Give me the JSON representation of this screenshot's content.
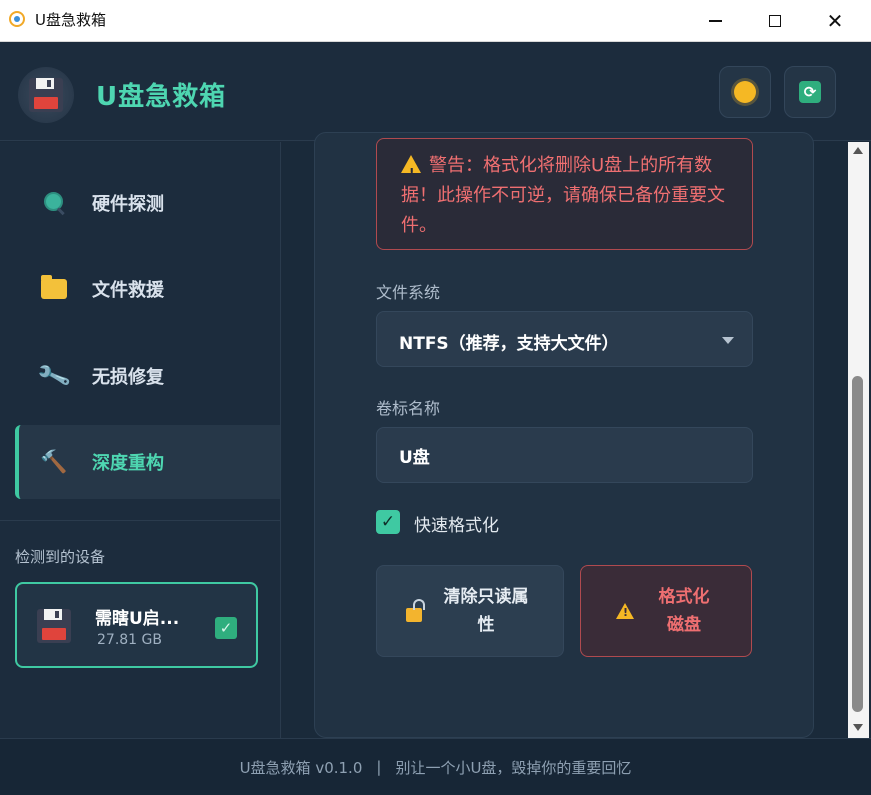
{
  "window": {
    "title": "U盘急救箱"
  },
  "header": {
    "brand": "U盘急救箱",
    "theme_icon": "sun-icon",
    "refresh_icon": "refresh-icon",
    "accent_color": "#4ed6b1"
  },
  "sidebar": {
    "items": [
      {
        "label": "硬件探测",
        "icon": "magnifier-icon",
        "active": false
      },
      {
        "label": "文件救援",
        "icon": "folder-icon",
        "active": false
      },
      {
        "label": "无损修复",
        "icon": "wrench-icon",
        "active": false
      },
      {
        "label": "深度重构",
        "icon": "hammer-icon",
        "active": true
      }
    ],
    "devices_title": "检测到的设备",
    "device": {
      "name": "需瞎U启...",
      "size": "27.81 GB",
      "checked": true
    }
  },
  "main": {
    "warning": "警告：格式化将删除U盘上的所有数据！此操作不可逆，请确保已备份重要文件。",
    "filesystem_label": "文件系统",
    "filesystem_value": "NTFS（推荐，支持大文件）",
    "volume_label": "卷标名称",
    "volume_value": "U盘",
    "quick_format_label": "快速格式化",
    "quick_format_checked": true,
    "clear_readonly_label": "清除只读属性",
    "format_label": "格式化磁盘",
    "danger_color": "#ef6f71"
  },
  "footer": {
    "version": "U盘急救箱 v0.1.0",
    "separator": "|",
    "slogan": "别让一个小U盘，毁掉你的重要回忆"
  }
}
